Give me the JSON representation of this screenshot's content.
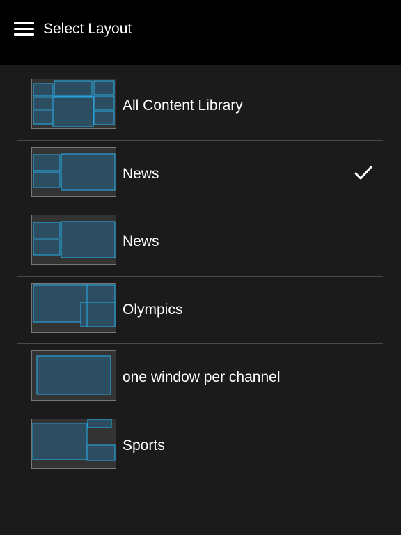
{
  "header": {
    "title": "Select Layout",
    "menu_icon": "hamburger-menu-icon"
  },
  "layouts": [
    {
      "label": "All Content Library",
      "selected": false
    },
    {
      "label": "News",
      "selected": true
    },
    {
      "label": "News",
      "selected": false
    },
    {
      "label": "Olympics",
      "selected": false
    },
    {
      "label": "one window per channel",
      "selected": false
    },
    {
      "label": "Sports",
      "selected": false
    }
  ],
  "colors": {
    "header_bg": "#000000",
    "page_bg": "#1b1b1b",
    "accent": "#2a9fd6",
    "divider": "#4a4a4a"
  },
  "icons": {
    "selected": "checkmark-icon"
  }
}
